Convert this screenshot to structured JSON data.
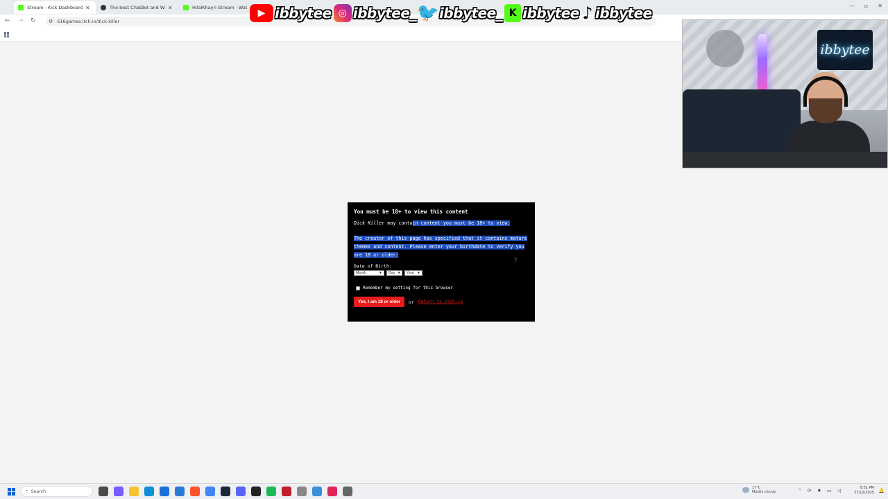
{
  "browser": {
    "tabs": [
      {
        "label": "Stream - Kick Dashboard",
        "favicon": "kick-icon"
      },
      {
        "label": "The best ChatBot and Widgets",
        "favicon": "github-icon"
      },
      {
        "label": "HilalKhayri Stream - Watch Live",
        "favicon": "kick-icon"
      }
    ],
    "url": "616games.itch.io/dick-killer"
  },
  "overlay": {
    "socials": [
      {
        "platform": "youtube-icon",
        "handle": "ibbytee"
      },
      {
        "platform": "instagram-icon",
        "handle": "ibbytee_"
      },
      {
        "platform": "twitter-icon",
        "handle": "ibbytee_"
      },
      {
        "platform": "kick-icon",
        "handle": "ibbytee"
      },
      {
        "platform": "tiktok-icon",
        "handle": "ibbytee"
      }
    ],
    "webcam_sign": "ibbytee"
  },
  "age_gate": {
    "title": "You must be 18+ to view this content",
    "game_name": "Dick Killer",
    "intro_rest_plain": " may conta",
    "intro_rest_highlighted": "in content you must be 18+ to view.",
    "description": "The creator of this page has specified that it contains mature themes and content. Please enter your birthdate to verify you are 18 or older:",
    "dob_label": "Date of Birth:",
    "month_value": "Month",
    "day_value": "Day",
    "year_value": "Year",
    "remember_label": "Remember my setting for this browser",
    "confirm_button": "Yes, I am 18 or older",
    "or_text": "or",
    "return_link": "Return to itch.io"
  },
  "taskbar": {
    "search_placeholder": "Search",
    "weather_temp": "17°C",
    "weather_desc": "Mostly cloudy",
    "time": "8:51 PM",
    "date": "27/12/2025"
  },
  "colors": {
    "accent_red": "#e81c1c",
    "selection_blue": "#1f4fbf",
    "kick_green": "#53fc18"
  }
}
